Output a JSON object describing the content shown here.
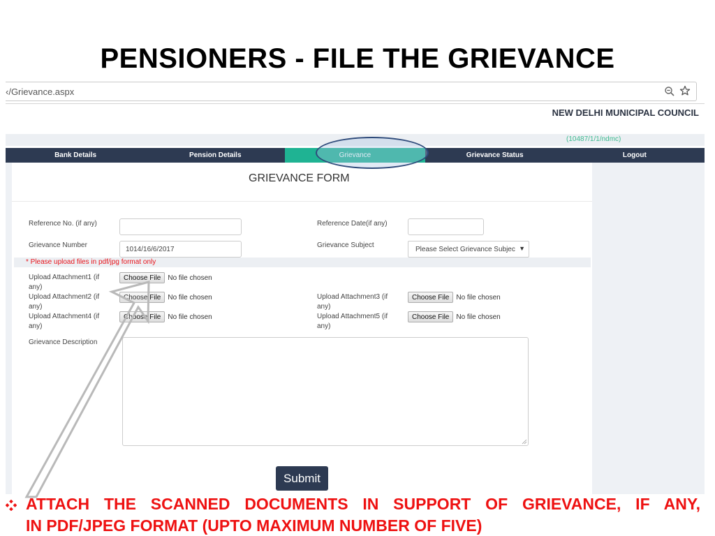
{
  "slide": {
    "title": "PENSIONERS - FILE THE GRIEVANCE",
    "note_line1": "ATTACH THE SCANNED DOCUMENTS IN SUPPORT OF GRIEVANCE, IF ANY,",
    "note_line2": "IN PDF/JPEG FORMAT (UPTO MAXIMUM NUMBER OF FIVE)",
    "bullet_icon": "diamond-bullet-icon",
    "note_color": "#ee1111"
  },
  "browser": {
    "url": "‹/Grievance.aspx",
    "zoom_icon": "zoom-out-icon",
    "bookmark_icon": "star-icon"
  },
  "header": {
    "org_name": "NEW DELHI MUNICIPAL COUNCIL",
    "user_id": "(10487/1/1/ndmc)"
  },
  "nav": {
    "items": [
      {
        "label": "Bank Details",
        "active": false
      },
      {
        "label": "Pension Details",
        "active": false
      },
      {
        "label": "Grievance",
        "active": true
      },
      {
        "label": "Grievance Status",
        "active": false
      },
      {
        "label": "Logout",
        "active": false
      }
    ],
    "bg_color": "#2d3a52",
    "active_color": "#1fb393"
  },
  "form": {
    "title": "GRIEVANCE FORM",
    "reference_no": {
      "label": "Reference No. (if any)",
      "value": ""
    },
    "reference_date": {
      "label": "Reference Date(if any)",
      "value": ""
    },
    "grievance_number": {
      "label": "Grievance Number",
      "value": "1014/16/6/2017"
    },
    "grievance_subject": {
      "label": "Grievance Subject",
      "selected": "Please Select Grievance Subjec"
    },
    "upload_warning": "* Please upload files in pdf/jpg format only",
    "attachments": [
      {
        "label": "Upload Attachment1 (if any)",
        "button": "Choose File",
        "status": "No file chosen"
      },
      {
        "label": "Upload Attachment2 (if any)",
        "button": "Choose File",
        "status": "No file chosen"
      },
      {
        "label": "Upload Attachment3 (if any)",
        "button": "Choose File",
        "status": "No file chosen"
      },
      {
        "label": "Upload Attachment4 (if any)",
        "button": "Choose File",
        "status": "No file chosen"
      },
      {
        "label": "Upload Attachment5 (if any)",
        "button": "Choose File",
        "status": "No file chosen"
      }
    ],
    "description": {
      "label": "Grievance Description",
      "value": ""
    },
    "submit_label": "Submit"
  }
}
